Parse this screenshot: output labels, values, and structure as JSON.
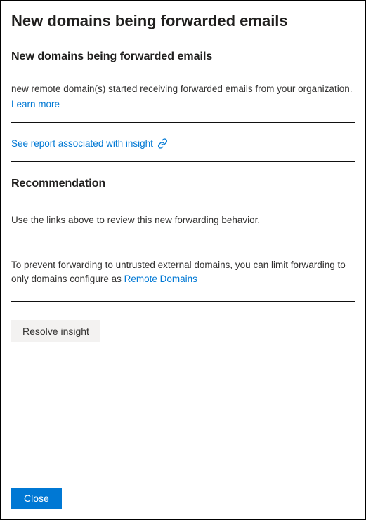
{
  "header": {
    "title": "New domains being forwarded emails"
  },
  "section1": {
    "heading": "New domains being forwarded emails",
    "body": "new remote domain(s) started receiving forwarded emails from your organization.",
    "learn_more": "Learn more"
  },
  "report_link": {
    "label": "See report associated with insight"
  },
  "recommendation": {
    "heading": "Recommendation",
    "line1": "Use the links above to review this new forwarding behavior.",
    "prevent_prefix": "To prevent forwarding to untrusted external domains, you can limit forwarding to only domains configure as ",
    "remote_domains_link": "Remote Domains"
  },
  "actions": {
    "resolve": "Resolve insight",
    "close": "Close"
  }
}
